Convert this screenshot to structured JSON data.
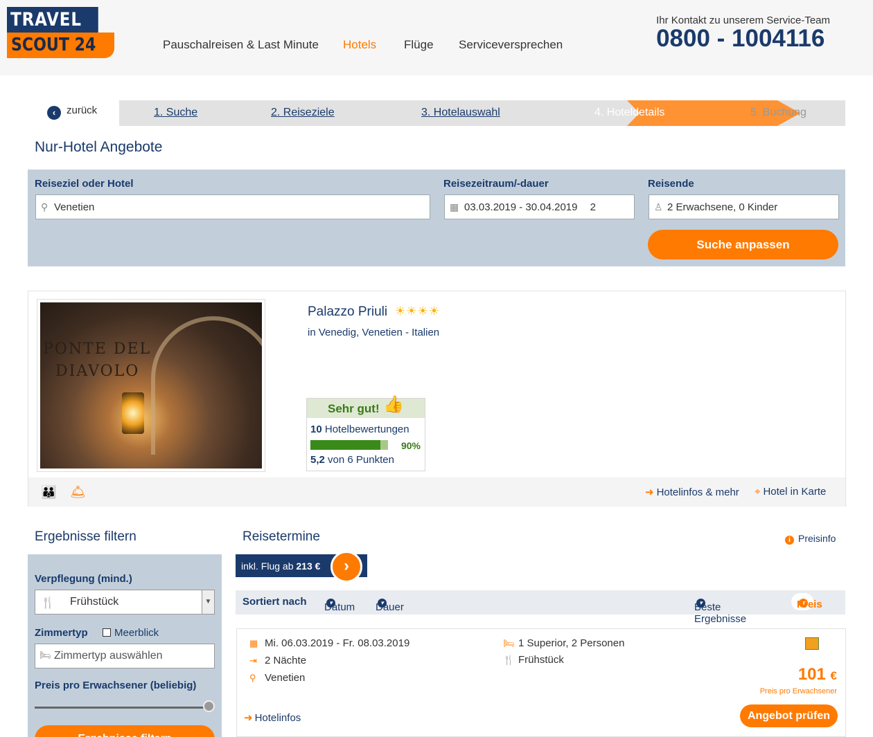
{
  "logo": {
    "line1": "TRAVEL",
    "line2": "SCOUT 24"
  },
  "nav": {
    "items": [
      "Pauschalreisen & Last Minute",
      "Hotels",
      "Flüge",
      "Serviceversprechen"
    ]
  },
  "contact": {
    "text": "Ihr Kontakt zu unserem Service-Team",
    "phone": "0800 - 1004116"
  },
  "steps": {
    "back": "zurück",
    "items": [
      "1. Suche",
      "2. Reiseziele",
      "3. Hotelauswahl",
      "4. Hoteldetails",
      "5. Buchung"
    ]
  },
  "page_title": "Nur-Hotel Angebote",
  "search": {
    "dest_label": "Reiseziel oder Hotel",
    "dest_value": "Venetien",
    "date_label": "Reisezeitraum/-dauer",
    "date_value": "03.03.2019 - 30.04.2019",
    "duration": "2",
    "travelers_label": "Reisende",
    "travelers_value": "2 Erwachsene, 0 Kinder",
    "submit": "Suche anpassen"
  },
  "hotel": {
    "name": "Palazzo Priuli",
    "stars": "☀☀☀☀",
    "location": "in Venedig, Venetien - Italien",
    "photo_text": [
      "PONTE DEL",
      "DIAVOLO"
    ],
    "rating_label": "Sehr gut!",
    "reviews_count": "10",
    "reviews_text": "Hotelbewertungen",
    "recommend_pct": "90%",
    "recommend_fraction": 0.9,
    "score": "5,2",
    "score_text": "von 6 Punkten",
    "link_info": "Hotelinfos & mehr",
    "link_map": "Hotel in Karte"
  },
  "filter": {
    "title": "Ergebnisse filtern",
    "board_label": "Verpflegung (mind.)",
    "board_value": "Frühstück",
    "room_label": "Zimmertyp",
    "seaview": "Meerblick",
    "room_placeholder": "Zimmertyp auswählen",
    "price_label": "Preis pro Erwachsener (beliebig)",
    "slider_fraction": 1.0,
    "apply": "Ergebnisse filtern"
  },
  "results": {
    "title": "Reisetermine",
    "priceinfo": "Preisinfo",
    "flight_prefix": "inkl. Flug ab",
    "flight_price": "213 €",
    "sort_label": "Sortiert nach",
    "sort_date": "Datum",
    "sort_duration": "Dauer",
    "sort_best": "Beste Ergebnisse",
    "sort_price": "Preis"
  },
  "offer": {
    "dates": "Mi. 06.03.2019 - Fr. 08.03.2019",
    "nights": "2 Nächte",
    "region": "Venetien",
    "room": "1 Superior, 2 Personen",
    "board": "Frühstück",
    "price": "101",
    "currency": "€",
    "price_label": "Preis pro Erwachsener",
    "hotelinfo": "Hotelinfos",
    "cta": "Angebot prüfen"
  },
  "colors": {
    "brand_blue": "#1a3a6b",
    "brand_orange": "#ff7a00",
    "search_bg": "#c2cfdb",
    "rating_green": "#3a8a1a"
  }
}
